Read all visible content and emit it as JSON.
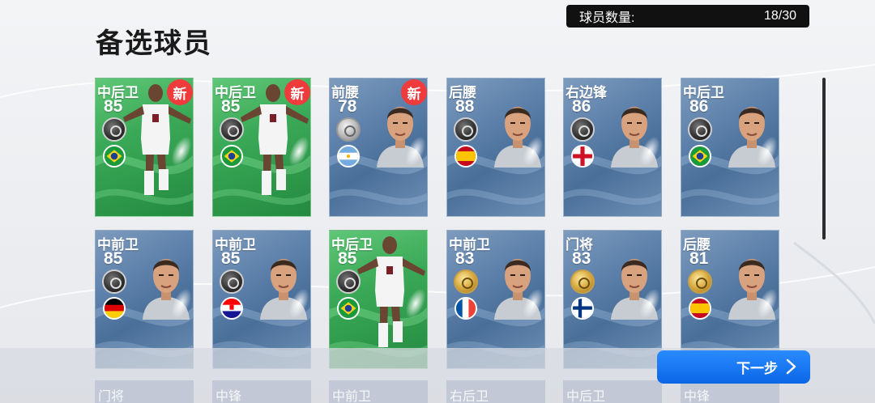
{
  "page": {
    "title": "备选球员"
  },
  "count": {
    "label": "球员数量:",
    "value": "18/30"
  },
  "cards": [
    {
      "pos": "中后卫",
      "rating": "85",
      "style": "green",
      "new": "新",
      "badge": "dark",
      "flag": "brazil-flag-icon",
      "art": "fullbody"
    },
    {
      "pos": "中后卫",
      "rating": "85",
      "style": "green",
      "new": "新",
      "badge": "dark",
      "flag": "brazil-flag-icon",
      "art": "fullbody"
    },
    {
      "pos": "前腰",
      "rating": "78",
      "style": "blue",
      "new": "新",
      "badge": "silver",
      "flag": "argentina-flag-icon",
      "art": "face"
    },
    {
      "pos": "后腰",
      "rating": "88",
      "style": "blue",
      "badge": "dark",
      "flag": "spain-flag-icon",
      "art": "face"
    },
    {
      "pos": "右边锋",
      "rating": "86",
      "style": "blue",
      "badge": "dark",
      "flag": "england-flag-icon",
      "art": "face"
    },
    {
      "pos": "中后卫",
      "rating": "86",
      "style": "blue",
      "badge": "dark",
      "flag": "brazil-flag-icon",
      "art": "face"
    },
    {
      "pos": "中前卫",
      "rating": "85",
      "style": "blue",
      "badge": "dark",
      "flag": "germany-flag-icon",
      "art": "face"
    },
    {
      "pos": "中前卫",
      "rating": "85",
      "style": "blue",
      "badge": "dark",
      "flag": "croatia-flag-icon",
      "art": "face"
    },
    {
      "pos": "中后卫",
      "rating": "85",
      "style": "green",
      "badge": "dark",
      "flag": "brazil-flag-icon",
      "art": "fullbody"
    },
    {
      "pos": "中前卫",
      "rating": "83",
      "style": "blue",
      "badge": "gold",
      "flag": "france-flag-icon",
      "art": "face"
    },
    {
      "pos": "门将",
      "rating": "83",
      "style": "blue",
      "badge": "gold",
      "flag": "finland-flag-icon",
      "art": "face"
    },
    {
      "pos": "后腰",
      "rating": "81",
      "style": "blue",
      "badge": "gold",
      "flag": "spain-flag-icon",
      "art": "face"
    }
  ],
  "next_row": [
    "门将",
    "中锋",
    "中前卫",
    "右后卫",
    "中后卫",
    "中锋"
  ],
  "next_button": {
    "label": "下一步"
  },
  "colors": {
    "accent": "#0b66e6",
    "new_badge": "#ef3b3b",
    "green_card": "#3aa957",
    "blue_card": "#5d81ab"
  }
}
